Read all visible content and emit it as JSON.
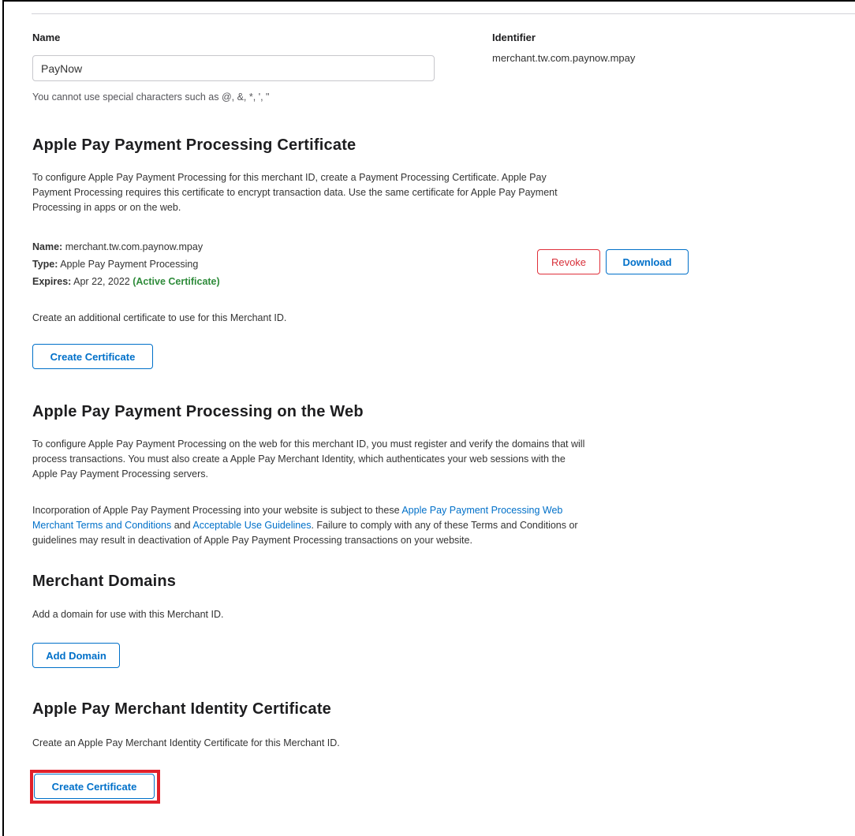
{
  "name_field": {
    "label": "Name",
    "value": "PayNow",
    "hint": "You cannot use special characters such as @, &, *, ', \""
  },
  "identifier": {
    "label": "Identifier",
    "value": "merchant.tw.com.paynow.mpay"
  },
  "processing_cert": {
    "heading": "Apple Pay Payment Processing Certificate",
    "description_lines": [
      "To configure Apple Pay Payment Processing for this merchant ID, create a Payment Processing Certificate. Apple Pay",
      "Payment Processing requires this certificate to encrypt transaction data. Use the same certificate for Apple Pay Payment",
      "Processing in apps or on the web."
    ],
    "cert_name_label": "Name:",
    "cert_name_value": "merchant.tw.com.paynow.mpay",
    "cert_type_label": "Type:",
    "cert_type_value": "Apple Pay Payment Processing",
    "cert_expires_label": "Expires:",
    "cert_expires_value": "Apr 22, 2022",
    "cert_status": "(Active Certificate)",
    "revoke_label": "Revoke",
    "download_label": "Download",
    "additional_text": "Create an additional certificate to use for this Merchant ID.",
    "create_label": "Create Certificate"
  },
  "web_processing": {
    "heading": "Apple Pay Payment Processing on the Web",
    "description_lines": [
      "To configure Apple Pay Payment Processing on the web for this merchant ID, you must register and verify the domains that will",
      "process transactions. You must also create a Apple Pay Merchant Identity, which authenticates your web sessions with the",
      "Apple Pay Payment Processing servers."
    ],
    "terms_prefix": "Incorporation of Apple Pay Payment Processing into your website is subject to these ",
    "terms_link_line1": "Apple Pay Payment Processing Web",
    "terms_link_line2": "Merchant Terms and Conditions",
    "terms_and": " and ",
    "guidelines_link": "Acceptable Use Guidelines",
    "terms_suffix": ". Failure to comply with any of these Terms and Conditions or",
    "terms_last_line": "guidelines may result in deactivation of Apple Pay Payment Processing transactions on your website."
  },
  "merchant_domains": {
    "heading": "Merchant Domains",
    "description": "Add a domain for use with this Merchant ID.",
    "add_label": "Add Domain"
  },
  "identity_cert": {
    "heading": "Apple Pay Merchant Identity Certificate",
    "description": "Create an Apple Pay Merchant Identity Certificate for this Merchant ID.",
    "create_label": "Create Certificate"
  },
  "colors": {
    "link": "#0070c9",
    "danger": "#d8303a",
    "active": "#2e8b3a",
    "highlight": "#e0202a"
  }
}
